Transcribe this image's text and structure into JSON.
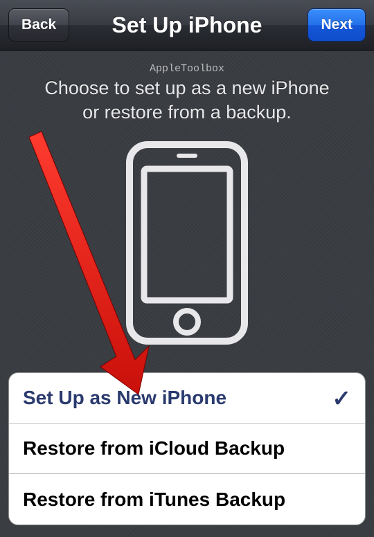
{
  "navbar": {
    "back_label": "Back",
    "title": "Set Up iPhone",
    "next_label": "Next"
  },
  "watermark": "AppleToolbox",
  "description_line1": "Choose to set up as a new iPhone",
  "description_line2": "or restore from a backup.",
  "options": [
    {
      "label": "Set Up as New iPhone",
      "selected": true
    },
    {
      "label": "Restore from iCloud Backup",
      "selected": false
    },
    {
      "label": "Restore from iTunes Backup",
      "selected": false
    }
  ],
  "colors": {
    "accent": "#2a3a6e",
    "next_button": "#1763e2"
  }
}
